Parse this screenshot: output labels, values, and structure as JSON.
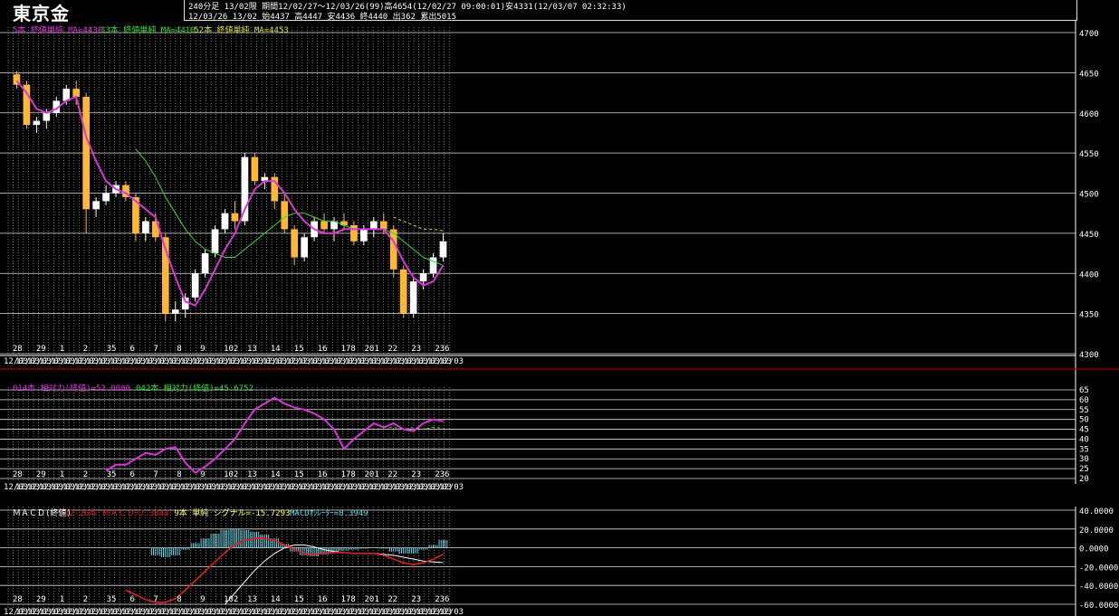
{
  "app": {
    "title": "東京金"
  },
  "info": {
    "line1": "240分足 13/02限 期間12/02/27〜12/03/26(99)高4654(12/02/27 09:00:01)安4331(12/03/07 02:32:33)",
    "line2": "12/03/26 13/02 始4437 高4447 安4436 終4440 出362 累出5015"
  },
  "colors": {
    "up": "#ffffff",
    "down": "#ffb833",
    "ma5": "#dd33dd",
    "ma13": "#33dd33",
    "ma52": "#dddd33",
    "rsi14": "#dd33dd",
    "rsi42": "#33dd33",
    "macd": "#dd2222",
    "signal": "#ffffff",
    "hist": "#66ddee",
    "separator": "#cc0000"
  },
  "price_panel": {
    "legend": [
      {
        "text": "5本 終値単純 MA=4430",
        "color": "#dd33dd"
      },
      {
        "text": "13本 終値単純 MA=4410",
        "color": "#33dd33"
      },
      {
        "text": "52本 終値単純 MA=4453",
        "color": "#dddd33"
      }
    ],
    "y_labels": [
      "4700",
      "4650",
      "4600",
      "4550",
      "4500",
      "4450",
      "4400",
      "4350",
      "4300"
    ]
  },
  "rsi_panel": {
    "legend": [
      {
        "text": "014本 相対力(終値)=52.0080",
        "color": "#dd33dd"
      },
      {
        "text": "042本 相対力(終値)=45.6752",
        "color": "#33dd33"
      }
    ],
    "y_labels": [
      "65",
      "60",
      "55",
      "50",
      "45",
      "40",
      "35",
      "30",
      "25",
      "20"
    ]
  },
  "macd_panel": {
    "legend": [
      {
        "text": "ＭＡＣＤ(終値)",
        "color": "#ffffff"
      },
      {
        "text": "12-26本 ＭＡＣＤ=7.3844",
        "color": "#dd2222"
      },
      {
        "text": "9本 単純 シグナル=-15.7293",
        "color": "#ffff66"
      },
      {
        "text": "MACDｵｼﾚｰﾀｰ=8.3949",
        "color": "#66ddee"
      }
    ],
    "y_labels": [
      "40.0000",
      "20.0000",
      "0.0000",
      "-20.0000",
      "-40.0000",
      "-60.0000"
    ]
  },
  "day_labels": [
    "28",
    "29",
    "1",
    "2",
    "35",
    "6",
    "7",
    "8",
    "9",
    "102",
    "13",
    "14",
    "15",
    "16",
    "178",
    "201",
    "22",
    "23",
    "236"
  ],
  "date_strip_text": "12/03",
  "chart_data": [
    {
      "type": "candlestick",
      "ylim": [
        4300,
        4700
      ],
      "bars": [
        [
          4648,
          4652,
          4630,
          4635
        ],
        [
          4635,
          4640,
          4580,
          4585
        ],
        [
          4585,
          4595,
          4575,
          4590
        ],
        [
          4590,
          4605,
          4580,
          4600
        ],
        [
          4600,
          4620,
          4595,
          4615
        ],
        [
          4615,
          4635,
          4610,
          4630
        ],
        [
          4630,
          4640,
          4610,
          4620
        ],
        [
          4620,
          4625,
          4450,
          4480
        ],
        [
          4480,
          4495,
          4470,
          4490
        ],
        [
          4490,
          4510,
          4485,
          4500
        ],
        [
          4500,
          4515,
          4495,
          4510
        ],
        [
          4510,
          4515,
          4490,
          4495
        ],
        [
          4495,
          4500,
          4440,
          4450
        ],
        [
          4450,
          4470,
          4440,
          4465
        ],
        [
          4465,
          4475,
          4440,
          4445
        ],
        [
          4445,
          4450,
          4340,
          4350
        ],
        [
          4350,
          4365,
          4340,
          4355
        ],
        [
          4355,
          4375,
          4345,
          4370
        ],
        [
          4370,
          4405,
          4365,
          4400
        ],
        [
          4400,
          4430,
          4395,
          4425
        ],
        [
          4425,
          4460,
          4420,
          4455
        ],
        [
          4455,
          4480,
          4450,
          4475
        ],
        [
          4475,
          4490,
          4455,
          4465
        ],
        [
          4465,
          4550,
          4460,
          4545
        ],
        [
          4545,
          4550,
          4510,
          4515
        ],
        [
          4515,
          4525,
          4505,
          4520
        ],
        [
          4520,
          4525,
          4480,
          4490
        ],
        [
          4490,
          4500,
          4450,
          4455
        ],
        [
          4455,
          4460,
          4410,
          4420
        ],
        [
          4420,
          4450,
          4415,
          4445
        ],
        [
          4445,
          4470,
          4440,
          4465
        ],
        [
          4465,
          4475,
          4450,
          4455
        ],
        [
          4455,
          4470,
          4440,
          4465
        ],
        [
          4465,
          4475,
          4455,
          4460
        ],
        [
          4460,
          4465,
          4435,
          4440
        ],
        [
          4440,
          4460,
          4435,
          4455
        ],
        [
          4455,
          4470,
          4445,
          4465
        ],
        [
          4465,
          4475,
          4450,
          4455
        ],
        [
          4455,
          4460,
          4395,
          4405
        ],
        [
          4405,
          4410,
          4345,
          4350
        ],
        [
          4350,
          4395,
          4345,
          4390
        ],
        [
          4390,
          4405,
          4380,
          4400
        ],
        [
          4400,
          4425,
          4395,
          4420
        ],
        [
          4420,
          4450,
          4415,
          4440
        ]
      ],
      "ma5": [
        4640,
        4625,
        4605,
        4600,
        4605,
        4615,
        4620,
        4570,
        4540,
        4515,
        4505,
        4500,
        4490,
        4480,
        4470,
        4430,
        4395,
        4365,
        4360,
        4380,
        4405,
        4430,
        4450,
        4480,
        4505,
        4515,
        4515,
        4500,
        4480,
        4465,
        4455,
        4450,
        4450,
        4455,
        4455,
        4455,
        4455,
        4455,
        4440,
        4415,
        4395,
        4385,
        4390,
        4410
      ],
      "ma13": [
        null,
        null,
        null,
        null,
        null,
        null,
        null,
        null,
        null,
        null,
        null,
        null,
        4555,
        4540,
        4520,
        4495,
        4475,
        4455,
        4440,
        4430,
        4425,
        4420,
        4420,
        4430,
        4440,
        4450,
        4460,
        4470,
        4475,
        4475,
        4470,
        4465,
        4465,
        4460,
        4455,
        4455,
        4455,
        4455,
        4450,
        4440,
        4430,
        4420,
        4415,
        4410
      ],
      "ma52_tail": [
        4470,
        4465,
        4460,
        4455,
        4455,
        4453
      ]
    },
    {
      "type": "line",
      "ylim": [
        20,
        65
      ],
      "rsi14": [
        null,
        null,
        null,
        null,
        null,
        null,
        null,
        null,
        null,
        24,
        27,
        27,
        30,
        33,
        32,
        35,
        36,
        28,
        23,
        26,
        30,
        35,
        40,
        48,
        55,
        58,
        61,
        58,
        56,
        55,
        53,
        50,
        45,
        35,
        40,
        44,
        48,
        46,
        48,
        45,
        44,
        48,
        50,
        49
      ],
      "rsi42_tail": [
        46,
        46,
        45,
        46,
        45,
        46,
        45.6
      ]
    },
    {
      "type": "line+histogram",
      "ylim": [
        -60,
        40
      ],
      "macd": [
        null,
        null,
        null,
        null,
        null,
        null,
        null,
        null,
        null,
        null,
        null,
        -45,
        -50,
        -55,
        -58,
        -58,
        -54,
        -45,
        -35,
        -25,
        -15,
        -5,
        3,
        8,
        10,
        10,
        8,
        3,
        -2,
        -6,
        -7,
        -6,
        -5,
        -5,
        -6,
        -6,
        -6,
        -8,
        -12,
        -16,
        -18,
        -16,
        -12,
        -7
      ],
      "signal": [
        null,
        null,
        null,
        null,
        null,
        null,
        null,
        null,
        null,
        null,
        null,
        null,
        null,
        null,
        null,
        null,
        null,
        null,
        null,
        null,
        null,
        -60,
        -48,
        -36,
        -24,
        -14,
        -6,
        0,
        3,
        3,
        1,
        -2,
        -4,
        -5,
        -6,
        -6,
        -6,
        -7,
        -8,
        -10,
        -12,
        -14,
        -15,
        -15.7
      ],
      "hist": [
        0,
        0,
        0,
        0,
        0,
        0,
        0,
        0,
        0,
        0,
        0,
        0,
        0,
        0,
        -8,
        -10,
        -8,
        -2,
        5,
        10,
        15,
        19,
        20,
        19,
        17,
        14,
        10,
        4,
        -4,
        -8,
        -9,
        -7,
        -5,
        -3,
        -2,
        -1,
        0,
        -1,
        -4,
        -6,
        -6,
        -2,
        3,
        8.4
      ]
    }
  ]
}
